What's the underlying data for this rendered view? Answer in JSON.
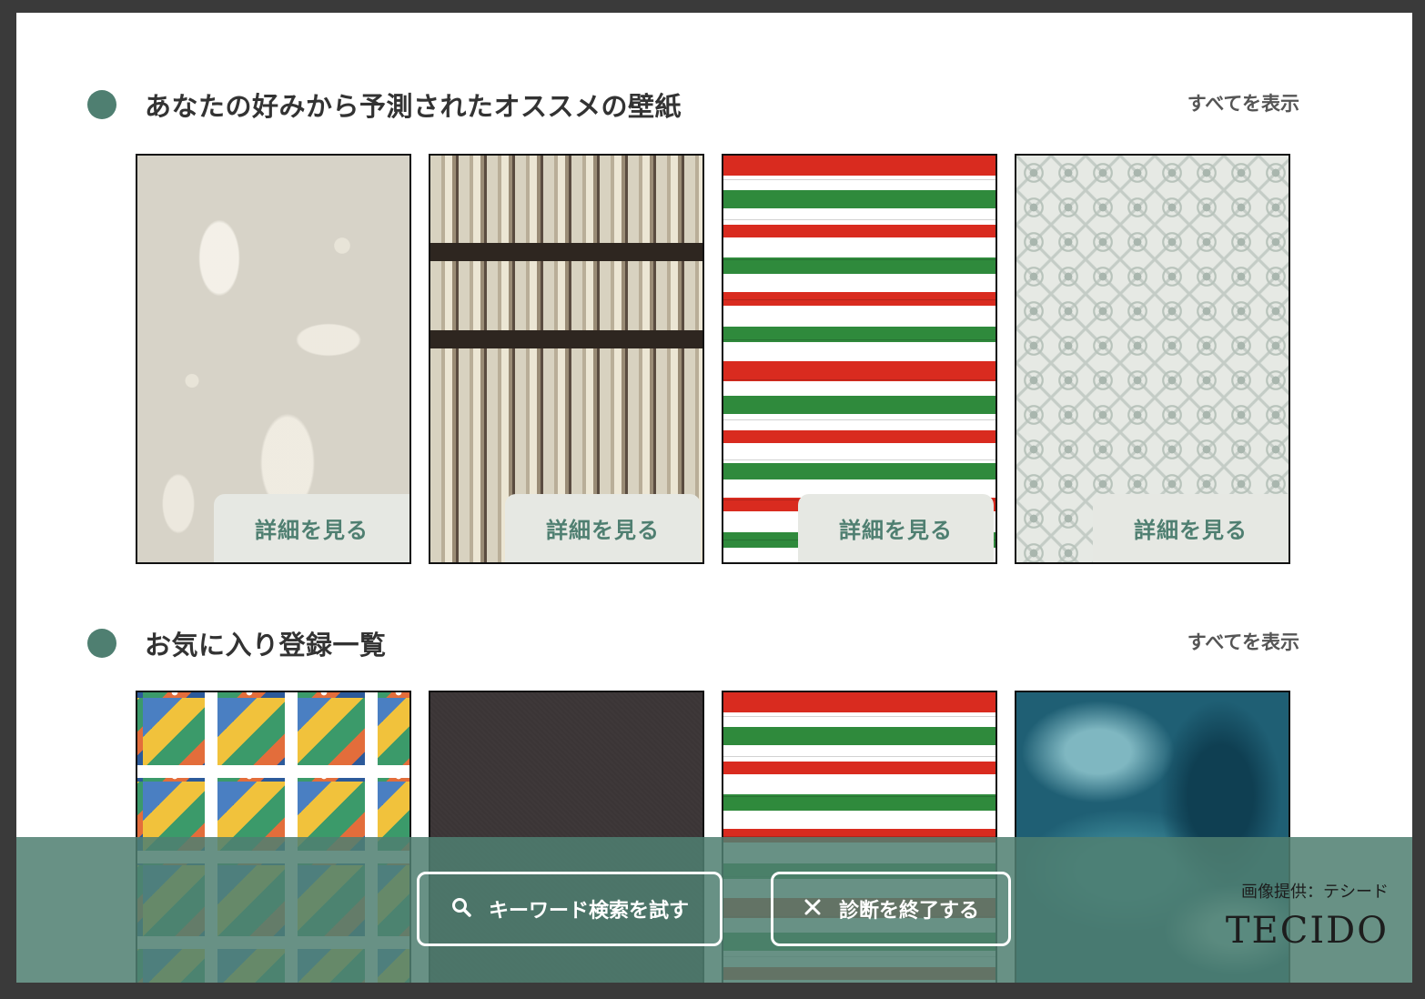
{
  "recommended": {
    "title": "あなたの好みから予測されたオススメの壁紙",
    "show_all": "すべてを表示",
    "cards": [
      {
        "detail_label": "詳細を見る",
        "pattern": "damask-beige"
      },
      {
        "detail_label": "詳細を見る",
        "pattern": "bookshelf"
      },
      {
        "detail_label": "詳細を見る",
        "pattern": "italian-stripes"
      },
      {
        "detail_label": "詳細を見る",
        "pattern": "green-tiles"
      }
    ]
  },
  "favorites": {
    "title": "お気に入り登録一覧",
    "show_all": "すべてを表示",
    "cards": [
      {
        "pattern": "travel-stamps"
      },
      {
        "pattern": "dark-plain"
      },
      {
        "pattern": "italian-stripes"
      },
      {
        "pattern": "ocean-watercolor"
      }
    ]
  },
  "bottom_bar": {
    "search_button": {
      "icon": "search-icon",
      "label": "キーワード検索を試す"
    },
    "end_button": {
      "icon": "close-icon",
      "label": "診断を終了する"
    },
    "credit_label": "画像提供：テシード",
    "credit_logo": "TECIDO"
  },
  "colors": {
    "accent": "#4f7f71",
    "detail_button_bg": "#e6e8e3",
    "bottom_bar_bg": "#4f7f71"
  }
}
